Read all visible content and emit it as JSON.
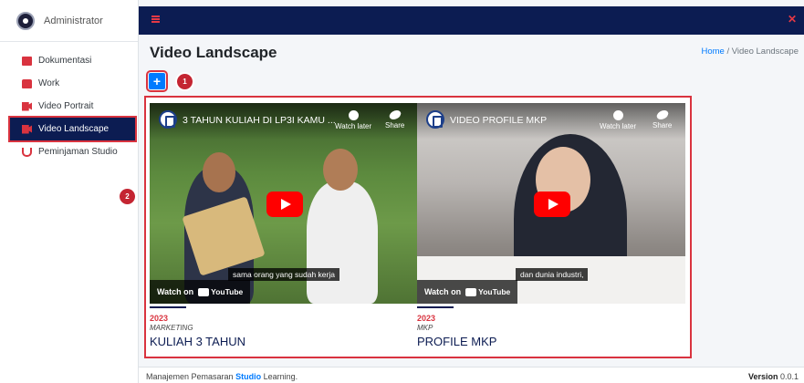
{
  "sidebar": {
    "user_name": "Administrator",
    "items": [
      {
        "label": "Dokumentasi"
      },
      {
        "label": "Work"
      },
      {
        "label": "Video Portrait"
      },
      {
        "label": "Video Landscape"
      },
      {
        "label": "Peminjaman Studio"
      }
    ]
  },
  "header": {
    "title": "Video Landscape",
    "breadcrumb_home": "Home",
    "breadcrumb_sep": "/",
    "breadcrumb_current": "Video Landscape"
  },
  "toolbar": {
    "add_label": "+"
  },
  "badges": [
    "1",
    "2"
  ],
  "videos": [
    {
      "player_title": "3 TAHUN KULIAH DI LP3I KAMU ...",
      "watch_later": "Watch later",
      "share": "Share",
      "caption": "sama orang yang sudah kerja",
      "watch_on": "Watch on",
      "youtube": "YouTube",
      "year": "2023",
      "category": "MARKETING",
      "title": "KULIAH 3 TAHUN"
    },
    {
      "player_title": "VIDEO PROFILE MKP",
      "watch_later": "Watch later",
      "share": "Share",
      "caption": "dan dunia industri,",
      "watch_on": "Watch on",
      "youtube": "YouTube",
      "year": "2023",
      "category": "MKP",
      "title": "PROFILE MKP"
    }
  ],
  "footer": {
    "text_prefix": "Manajemen Pemasaran",
    "text_brand": "Studio",
    "text_suffix": "Learning.",
    "version_label": "Version",
    "version_value": "0.0.1"
  },
  "colors": {
    "navy": "#0c1c52",
    "accent_red": "#d9333f",
    "link_blue": "#007bff"
  }
}
